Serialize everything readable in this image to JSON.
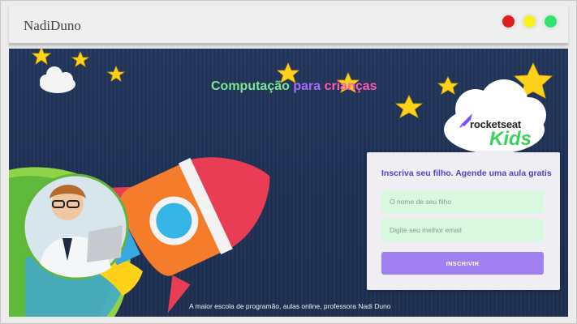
{
  "window": {
    "title": "NadiDuno",
    "controls": [
      {
        "name": "red-dot",
        "color": "#e01c1c"
      },
      {
        "name": "yellow-dot",
        "color": "#f6f21b"
      },
      {
        "name": "green-dot",
        "color": "#2ee66f"
      }
    ]
  },
  "hero": {
    "headline": {
      "w1": "Computação",
      "w2": "para",
      "w3": "crianças"
    },
    "logo": {
      "brand": "rocketseat",
      "sub": "Kids"
    },
    "footer": "A maior escola de programão, aulas online, professora Nadi Duno"
  },
  "form": {
    "title": "Inscriva seu filho. Agende uma aula gratis",
    "name_placeholder": "O nome de seu filho",
    "email_placeholder": "Digite seu melhor email",
    "submit_label": "INSCRIVIR"
  },
  "colors": {
    "background": "#1f3155",
    "accent": "#a07ff0",
    "field": "#d8f8df",
    "form_title": "#5a3fc0",
    "star": "#ffd21a"
  }
}
